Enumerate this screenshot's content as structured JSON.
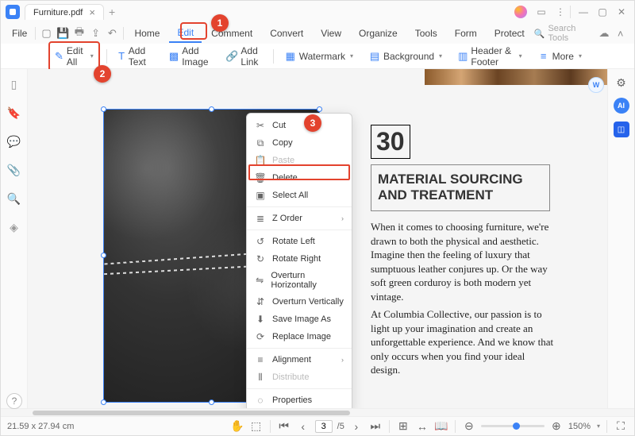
{
  "titlebar": {
    "tab_name": "Furniture.pdf",
    "win_min": "—",
    "win_max": "▢",
    "win_close": "✕"
  },
  "menubar": {
    "file": "File",
    "tabs": {
      "home": "Home",
      "edit": "Edit",
      "comment": "Comment",
      "convert": "Convert",
      "view": "View",
      "organize": "Organize",
      "tools": "Tools",
      "form": "Form",
      "protect": "Protect"
    },
    "search_placeholder": "Search Tools"
  },
  "toolbar": {
    "edit_all": "Edit All",
    "add_text": "Add Text",
    "add_image": "Add Image",
    "add_link": "Add Link",
    "watermark": "Watermark",
    "background": "Background",
    "header_footer": "Header & Footer",
    "more": "More"
  },
  "context_menu": {
    "cut": "Cut",
    "copy": "Copy",
    "paste": "Paste",
    "delete": "Delete",
    "select_all": "Select All",
    "z_order": "Z Order",
    "rotate_left": "Rotate Left",
    "rotate_right": "Rotate Right",
    "overturn_h": "Overturn Horizontally",
    "overturn_v": "Overturn Vertically",
    "save_image_as": "Save Image As",
    "replace_image": "Replace Image",
    "alignment": "Alignment",
    "distribute": "Distribute",
    "properties": "Properties"
  },
  "document": {
    "page_number": "30",
    "heading": "MATERIAL SOURCING AND TREATMENT",
    "para1": "When it comes to choosing furniture, we're drawn to both the physical and aesthetic. Imagine then the feeling of luxury that sumptuous leather conjures up. Or the way soft green corduroy is both modern yet vintage.",
    "para2": "At Columbia Collective, our passion is to light up your imagination and create an unforgettable experience. And we know that only occurs when you find your ideal design."
  },
  "callouts": {
    "c1": "1",
    "c2": "2",
    "c3": "3"
  },
  "status": {
    "doc_size": "21.59 x 27.94 cm",
    "page_current": "3",
    "page_total": "/5",
    "zoom": "150%"
  },
  "right_badges": {
    "ai": "AI",
    "word": "W"
  }
}
